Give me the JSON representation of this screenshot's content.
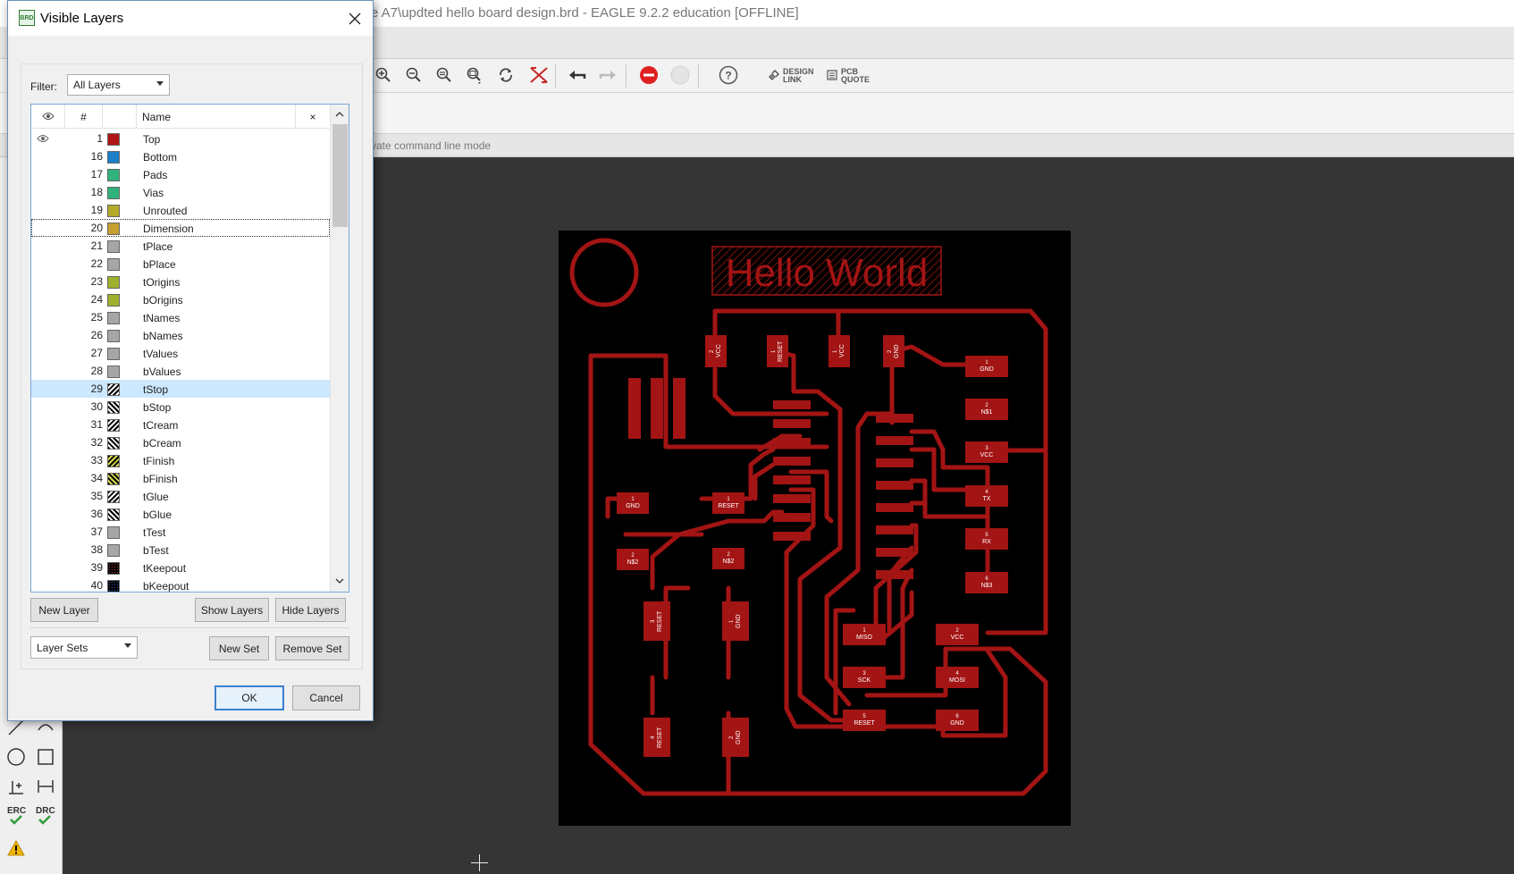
{
  "window": {
    "title": "e A7\\updted hello board design.brd - EAGLE 9.2.2 education [OFFLINE]",
    "command_hint": "vate command line mode"
  },
  "toolbar": {
    "design_link": [
      "DESIGN",
      "LINK"
    ],
    "pcb_quote": [
      "PCB",
      "QUOTE"
    ],
    "help": "?"
  },
  "left_tools": {
    "erc": "ERC",
    "drc": "DRC"
  },
  "dialog": {
    "title": "Visible Layers",
    "icon_text": "BRD",
    "filter_label": "Filter:",
    "filter_value": "All Layers",
    "columns": {
      "eye": "",
      "num": "#",
      "name": "Name",
      "close": "×"
    },
    "layers": [
      {
        "num": "1",
        "name": "Top",
        "color": "#b01515",
        "pattern": "solid",
        "visible": true
      },
      {
        "num": "16",
        "name": "Bottom",
        "color": "#1e7ec8",
        "pattern": "solid"
      },
      {
        "num": "17",
        "name": "Pads",
        "color": "#2fb37c",
        "pattern": "solid"
      },
      {
        "num": "18",
        "name": "Vias",
        "color": "#2fb37c",
        "pattern": "solid"
      },
      {
        "num": "19",
        "name": "Unrouted",
        "color": "#b5aa2a",
        "pattern": "solid"
      },
      {
        "num": "20",
        "name": "Dimension",
        "color": "#c5a030",
        "pattern": "solid",
        "focused": true
      },
      {
        "num": "21",
        "name": "tPlace",
        "color": "#a6a6a6",
        "pattern": "solid"
      },
      {
        "num": "22",
        "name": "bPlace",
        "color": "#a6a6a6",
        "pattern": "solid"
      },
      {
        "num": "23",
        "name": "tOrigins",
        "color": "#9fb02c",
        "pattern": "solid"
      },
      {
        "num": "24",
        "name": "bOrigins",
        "color": "#9fb02c",
        "pattern": "solid"
      },
      {
        "num": "25",
        "name": "tNames",
        "color": "#a6a6a6",
        "pattern": "solid"
      },
      {
        "num": "26",
        "name": "bNames",
        "color": "#a6a6a6",
        "pattern": "solid"
      },
      {
        "num": "27",
        "name": "tValues",
        "color": "#a6a6a6",
        "pattern": "solid"
      },
      {
        "num": "28",
        "name": "bValues",
        "color": "#a6a6a6",
        "pattern": "solid"
      },
      {
        "num": "29",
        "name": "tStop",
        "color": "#ffffff",
        "pattern": "hatch",
        "selected": true
      },
      {
        "num": "30",
        "name": "bStop",
        "color": "#ffffff",
        "pattern": "hatch-back"
      },
      {
        "num": "31",
        "name": "tCream",
        "color": "#ffffff",
        "pattern": "hatch"
      },
      {
        "num": "32",
        "name": "bCream",
        "color": "#ffffff",
        "pattern": "hatch-back"
      },
      {
        "num": "33",
        "name": "tFinish",
        "color": "#d8d850",
        "pattern": "hatch"
      },
      {
        "num": "34",
        "name": "bFinish",
        "color": "#d8d850",
        "pattern": "hatch-back"
      },
      {
        "num": "35",
        "name": "tGlue",
        "color": "#ffffff",
        "pattern": "hatch"
      },
      {
        "num": "36",
        "name": "bGlue",
        "color": "#ffffff",
        "pattern": "hatch-back"
      },
      {
        "num": "37",
        "name": "tTest",
        "color": "#a6a6a6",
        "pattern": "solid"
      },
      {
        "num": "38",
        "name": "bTest",
        "color": "#a6a6a6",
        "pattern": "solid"
      },
      {
        "num": "39",
        "name": "tKeepout",
        "color": "#c03030",
        "pattern": "dots"
      },
      {
        "num": "40",
        "name": "bKeepout",
        "color": "#3050c0",
        "pattern": "dots"
      }
    ],
    "buttons": {
      "new_layer": "New Layer",
      "show_layers": "Show Layers",
      "hide_layers": "Hide Layers",
      "layer_sets": "Layer Sets",
      "new_set": "New Set",
      "remove_set": "Remove Set",
      "ok": "OK",
      "cancel": "Cancel"
    }
  },
  "pcb": {
    "silk_text": "Hello World",
    "trace_color": "#a31414",
    "pads": [
      {
        "id": "p-vcc-2",
        "n": "2",
        "label": "VCC",
        "vertical": true
      },
      {
        "id": "p-reset-1",
        "n": "1",
        "label": "RESET",
        "vertical": true
      },
      {
        "id": "p-vcc-1",
        "n": "1",
        "label": "VCC",
        "vertical": true
      },
      {
        "id": "p-gnd-2t",
        "n": "2",
        "label": "GND",
        "vertical": true
      },
      {
        "id": "ftdi-1",
        "n": "1",
        "label": "GND"
      },
      {
        "id": "ftdi-2",
        "n": "2",
        "label": "N$1"
      },
      {
        "id": "ftdi-3",
        "n": "3",
        "label": "VCC"
      },
      {
        "id": "ftdi-4",
        "n": "4",
        "label": "TX"
      },
      {
        "id": "ftdi-5",
        "n": "5",
        "label": "RX"
      },
      {
        "id": "ftdi-6",
        "n": "6",
        "label": "N$3"
      },
      {
        "id": "c-gnd",
        "n": "1",
        "label": "GND"
      },
      {
        "id": "r-reset",
        "n": "1",
        "label": "RESET"
      },
      {
        "id": "c-n2a",
        "n": "2",
        "label": "N$2"
      },
      {
        "id": "r-n2b",
        "n": "2",
        "label": "N$2"
      },
      {
        "id": "sw-reset-3",
        "n": "3",
        "label": "RESET",
        "vertical": true
      },
      {
        "id": "sw-gnd-1",
        "n": "1",
        "label": "GND",
        "vertical": true
      },
      {
        "id": "sw-reset-4",
        "n": "4",
        "label": "RESET",
        "vertical": true
      },
      {
        "id": "sw-gnd-2",
        "n": "2",
        "label": "GND",
        "vertical": true
      },
      {
        "id": "isp-1",
        "n": "1",
        "label": "MISO"
      },
      {
        "id": "isp-2",
        "n": "2",
        "label": "VCC"
      },
      {
        "id": "isp-3",
        "n": "3",
        "label": "SCK"
      },
      {
        "id": "isp-4",
        "n": "4",
        "label": "MOSI"
      },
      {
        "id": "isp-5",
        "n": "5",
        "label": "RESET"
      },
      {
        "id": "isp-6",
        "n": "6",
        "label": "GND"
      }
    ]
  }
}
